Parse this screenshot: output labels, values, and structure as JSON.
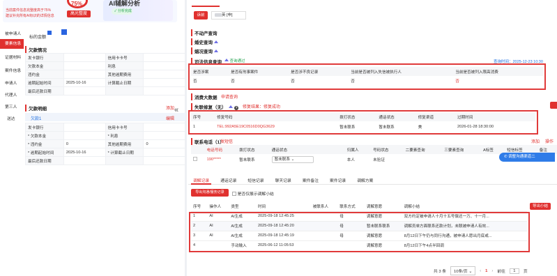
{
  "top_card": {
    "percent": "75%",
    "note_red": "当前案件信息完整度高于75%",
    "note_line2": "建议补充所有AI标识的详情信息",
    "button": "高光整度",
    "ai_title": "AI辅解分析",
    "ai_status": "分析完成"
  },
  "left_nav": [
    "被申请人",
    "要素信息",
    "证据材料",
    "案件信息",
    "申请人",
    "代理人",
    "第三人",
    "送达"
  ],
  "left": {
    "amount_label": "标的金额",
    "debt_title": "欠款情况",
    "debt_rows": [
      [
        "发卡银行",
        "",
        "信用卡卡号",
        ""
      ],
      [
        "欠款本金",
        "",
        "利息",
        ""
      ],
      [
        "违约金",
        "",
        "其他逾期费用",
        ""
      ],
      [
        "逾期起始时间",
        "2025-10-16",
        "计算截止日期",
        ""
      ],
      [
        "最后还款日期",
        "",
        "",
        ""
      ]
    ],
    "detail_title": "欠款明细",
    "add": "添加",
    "edit": "编辑",
    "debt1": "欠款1",
    "detail_rows": [
      [
        "发卡银行",
        "",
        "信用卡卡号",
        ""
      ],
      [
        "* 欠款本金",
        "",
        "* 利息",
        ""
      ],
      [
        "* 违约金",
        "0",
        "其他逾期费用",
        "0"
      ],
      [
        "* 逾期起始时间",
        "2025-10-16",
        "* 计算截止日期",
        ""
      ],
      [
        "最后还款日期",
        "",
        "",
        ""
      ]
    ]
  },
  "right": {
    "tab_active": "诉前",
    "tab_name_suffix": "英 [申]",
    "sections": [
      "不动产查询",
      "婚史查询",
      "姻况查询"
    ],
    "judicial_title": "司法信息查询",
    "judicial_status": "查询通过",
    "query_time": "查询时间：2025-12-23 10:30",
    "judicial_headers": [
      "是否涉案",
      "是否有刑事案件",
      "是否涉不良记录",
      "当前是否被列入失信被执行人",
      "当前是否被列入限高消费"
    ],
    "judicial_values": [
      "否",
      "否",
      "否",
      "否",
      "否"
    ],
    "consume_title": "消费大数据",
    "consume_link": "申请查询",
    "repair_title": "失联修复（无）",
    "repair_result": "修复结果：修复成功",
    "repair_headers": [
      "序号",
      "修复号码",
      "拨打状态",
      "通话状态",
      "修复渠道",
      "过期时间"
    ],
    "repair_row": [
      "1",
      "TEL:992A5E19C0516D0QG3629",
      "暂未联系",
      "暂未联系",
      "美",
      "2026-01-28 18:30:00"
    ],
    "contact_title": "联系电话（1）",
    "contact_link": "发短信",
    "contact_add": "添加",
    "contact_ops": "操作日",
    "contact_headers": [
      "电话号码",
      "拨打状态",
      "通话状态",
      "归属人",
      "号码状态",
      "二要素查询",
      "三要素查询",
      "A标签",
      "短信标签",
      "备注"
    ],
    "contact_row": [
      "190*****",
      "暂未联系",
      "暂未联系",
      "本人",
      "未验证"
    ],
    "chat_button": "调整沟通渠道二",
    "bottom_tabs": [
      "调解记录",
      "通话记录",
      "短信记录",
      "聊天记录",
      "案件备注",
      "案件记录",
      "调解方案"
    ],
    "export_btn": "导出沟通/服务记录",
    "only_show": "是否仅展示调解小结",
    "export_small": "导出小结",
    "med_headers": [
      "序号",
      "操作人",
      "类型",
      "时间",
      "被联系人",
      "联系方式",
      "调解意愿",
      "调解小结"
    ],
    "med_rows": [
      [
        "1",
        "AI",
        "AI生成",
        "2025-09-18 12:45:25",
        "",
        "母",
        "调解意愿",
        "双方约定被申请人十月十五号偿还一万、十一月..."
      ],
      [
        "2",
        "AI",
        "AI生成",
        "2025-09-18 12:45:20",
        "",
        "母",
        "暂未联系联系",
        "调解员单方面联系还款计划，未联被申请人有效..."
      ],
      [
        "3",
        "AI",
        "AI生成",
        "2025-09-18 12:45:19",
        "",
        "母",
        "调解意愿",
        "8月12日下午仍与同行沟通，被申请人愿出月底或..."
      ],
      [
        "4",
        "",
        "手动输入",
        "2025-06-12 11:05:53",
        "",
        "",
        "调解意愿",
        "8月12日下午4点半回调"
      ]
    ],
    "pager_total": "共 3 条",
    "pager_size": "10条/页",
    "pager_page": "1",
    "pager_goto": "前往",
    "pager_goto_val": "1",
    "pager_suffix": "页"
  }
}
